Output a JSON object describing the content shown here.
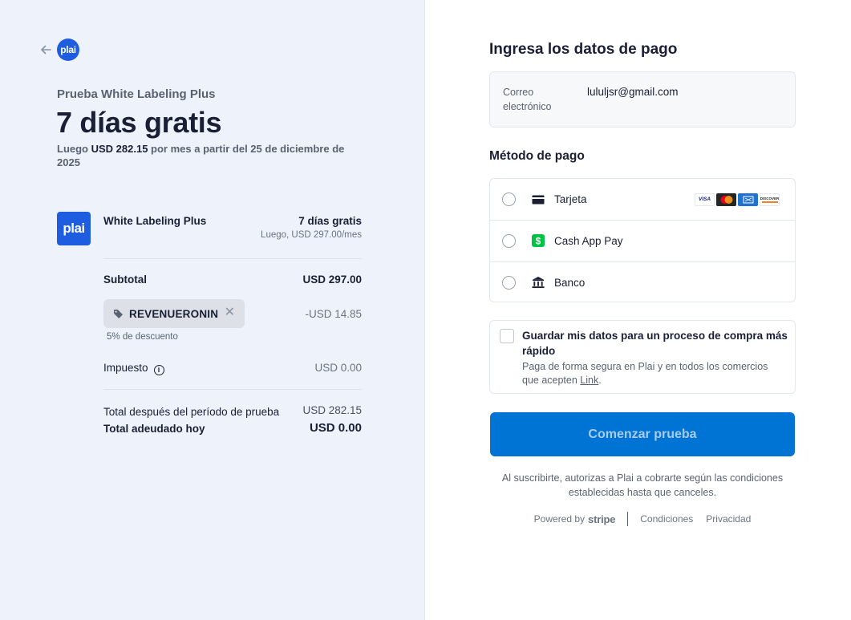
{
  "brand": {
    "logo_text": "plai",
    "color": "#1f5de0"
  },
  "summary": {
    "trial_subtitle": "Prueba White Labeling Plus",
    "trial_title": "7 días gratis",
    "later_prefix": "Luego ",
    "later_amount": "USD 282.15",
    "later_suffix": " por mes a partir del 25 de diciembre de 2025"
  },
  "line_item": {
    "name": "White Labeling Plus",
    "price": "7 días gratis",
    "price_later": "Luego, USD 297.00/mes"
  },
  "totals": {
    "subtotal_label": "Subtotal",
    "subtotal_value": "USD 297.00",
    "coupon_code": "REVENUERONIN",
    "coupon_discount": "-USD 14.85",
    "discount_note": "5% de descuento",
    "tax_label": "Impuesto",
    "tax_value": "USD 0.00",
    "after_trial_label": "Total después del período de prueba",
    "after_trial_value": "USD 282.15",
    "due_today_label": "Total adeudado hoy",
    "due_today_value": "USD 0.00"
  },
  "payment": {
    "title": "Ingresa los datos de pago",
    "email_label": "Correo electrónico",
    "email_value": "lululjsr@gmail.com",
    "method_title": "Método de pago",
    "methods": [
      {
        "label": "Tarjeta",
        "icon": "card-icon"
      },
      {
        "label": "Cash App Pay",
        "icon": "cash-app-icon"
      },
      {
        "label": "Banco",
        "icon": "bank-icon"
      }
    ],
    "card_brands": [
      "VISA",
      "mastercard",
      "amex",
      "DISCOVER"
    ],
    "save_title": "Guardar mis datos para un proceso de compra más rápido",
    "save_desc_prefix": "Paga de forma segura en Plai y en todos los comercios que acepten ",
    "save_desc_link": "Link",
    "save_desc_suffix": ".",
    "cta_label": "Comenzar prueba",
    "cta_color": "#0074d4",
    "legal": "Al suscribirte, autorizas a Plai a cobrarte según las condiciones establecidas hasta que canceles."
  },
  "footer": {
    "powered_by": "Powered by",
    "stripe": "stripe",
    "terms": "Condiciones",
    "privacy": "Privacidad"
  }
}
